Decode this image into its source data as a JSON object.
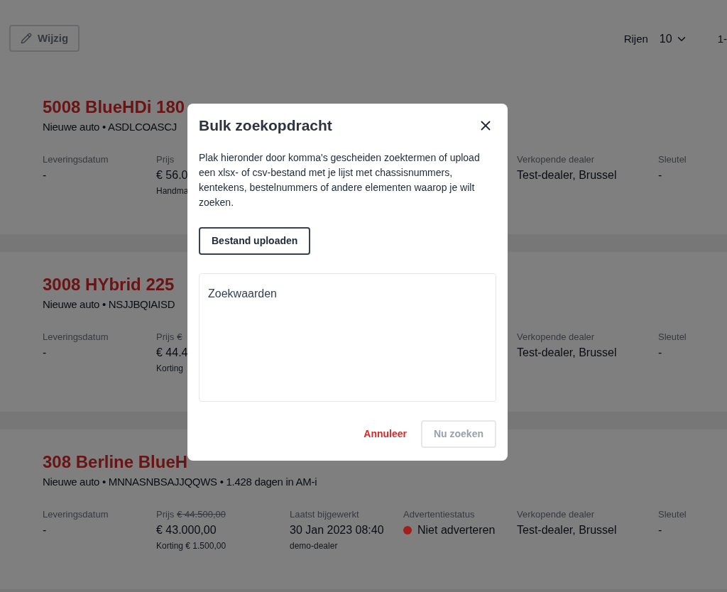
{
  "toolbar": {
    "edit_button": {
      "label": "Wijzig",
      "disabled": true
    },
    "rows_label": "Rijen",
    "rows_value": "10",
    "range": "1-"
  },
  "cards": [
    {
      "title": "5008 BlueHDi 180",
      "subtitle": "Nieuwe auto • ASDLCOASCJ",
      "fields_left": [
        {
          "label": "Leveringsdatum",
          "value": "-"
        },
        {
          "label": "Prijs",
          "value": "€ 56.0",
          "note": "Handma"
        }
      ],
      "fields_right": [
        {
          "label": "Verkopende dealer",
          "value": "Test-dealer, Brussel"
        },
        {
          "label": "Sleutel",
          "value": "-"
        }
      ]
    },
    {
      "title": "3008 HYbrid 225",
      "subtitle": "Nieuwe auto • NSJJBQIAISD",
      "fields_left": [
        {
          "label": "Leveringsdatum",
          "value": "-"
        },
        {
          "label": "Prijs",
          "old_price": "€",
          "value": "€ 44.4",
          "note": "Korting"
        }
      ],
      "fields_right": [
        {
          "label": "Verkopende dealer",
          "value": "Test-dealer, Brussel"
        },
        {
          "label": "Sleutel",
          "value": "-"
        }
      ]
    },
    {
      "title": "308 Berline BlueH",
      "subtitle": "Nieuwe auto • MNNASNBSAJJQQWS • 1.428 dagen in AM-i",
      "fields_left": [
        {
          "label": "Leveringsdatum",
          "value": "-"
        },
        {
          "label": "Prijs",
          "old_price": "€ 44.500,00",
          "value": "€ 43.000,00",
          "note": "Korting € 1.500,00"
        }
      ],
      "fields_middle": [
        {
          "label": "Laatst bijgewerkt",
          "value": "30 Jan 2023 08:40",
          "note": "demo-dealer"
        },
        {
          "label": "Advertentiestatus",
          "value": "Niet adverteren",
          "color": "#a31d1d"
        }
      ],
      "fields_right": [
        {
          "label": "Verkopende dealer",
          "value": "Test-dealer, Brussel"
        },
        {
          "label": "Sleutel",
          "value": "-"
        }
      ]
    }
  ],
  "modal": {
    "title": "Bulk zoekopdracht",
    "description": "Plak hieronder door komma's gescheiden zoektermen of upload een xlsx- of csv-bestand met je lijst met chassisnummers, kentekens, bestelnummers of andere elementen waarop je wilt zoeken.",
    "upload_button": "Bestand uploaden",
    "search_field": {
      "placeholder": "Zoekwaarden"
    },
    "cancel_button": "Annuleer",
    "submit_button": {
      "label": "Nu zoeken",
      "disabled": true
    }
  }
}
